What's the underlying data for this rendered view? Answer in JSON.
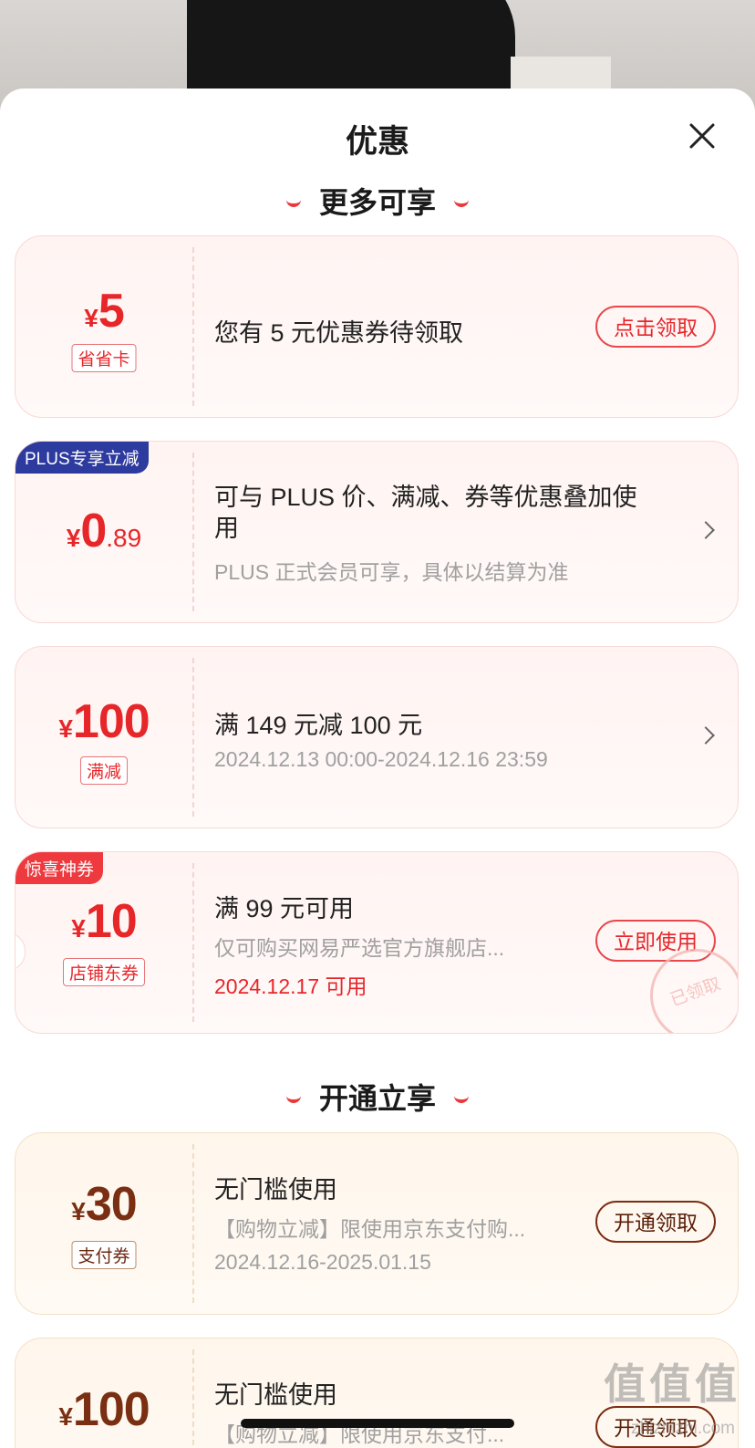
{
  "sheet": {
    "title": "优惠"
  },
  "sections": [
    {
      "title": "更多可享"
    },
    {
      "title": "开通立享"
    }
  ],
  "coupons": [
    {
      "currency": "¥",
      "amount": "5",
      "tag": "省省卡",
      "main": "您有 5 元优惠券待领取",
      "button": "点击领取"
    },
    {
      "badge": "PLUS专享立减",
      "currency": "¥",
      "amount": "0",
      "decimal": ".89",
      "main": "可与 PLUS 价、满减、券等优惠叠加使用",
      "sub": "PLUS 正式会员可享，具体以结算为准"
    },
    {
      "currency": "¥",
      "amount": "100",
      "tag": "满减",
      "main": "满 149 元减 100 元",
      "sub": "2024.12.13 00:00-2024.12.16 23:59"
    },
    {
      "badge": "惊喜神券",
      "currency": "¥",
      "amount": "10",
      "tag": "店铺东券",
      "main": "满 99 元可用",
      "sub": "仅可购买网易严选官方旗舰店...",
      "date": "2024.12.17 可用",
      "button": "立即使用",
      "stamp": "已领取"
    },
    {
      "currency": "¥",
      "amount": "30",
      "tag": "支付券",
      "main": "无门槛使用",
      "sub": "【购物立减】限使用京东支付购...",
      "date": "2024.12.16-2025.01.15",
      "button": "开通领取"
    },
    {
      "currency": "¥",
      "amount": "100",
      "main": "无门槛使用",
      "sub": "【购物立减】限使用京东支付...",
      "button": "开通领取"
    }
  ],
  "watermark": {
    "text": "值值值",
    "sub": "zhizhizhi.com"
  },
  "colors": {
    "accent": "#e7262a",
    "gold": "#7a2e12",
    "plus_badge": "#2d3a9e"
  }
}
